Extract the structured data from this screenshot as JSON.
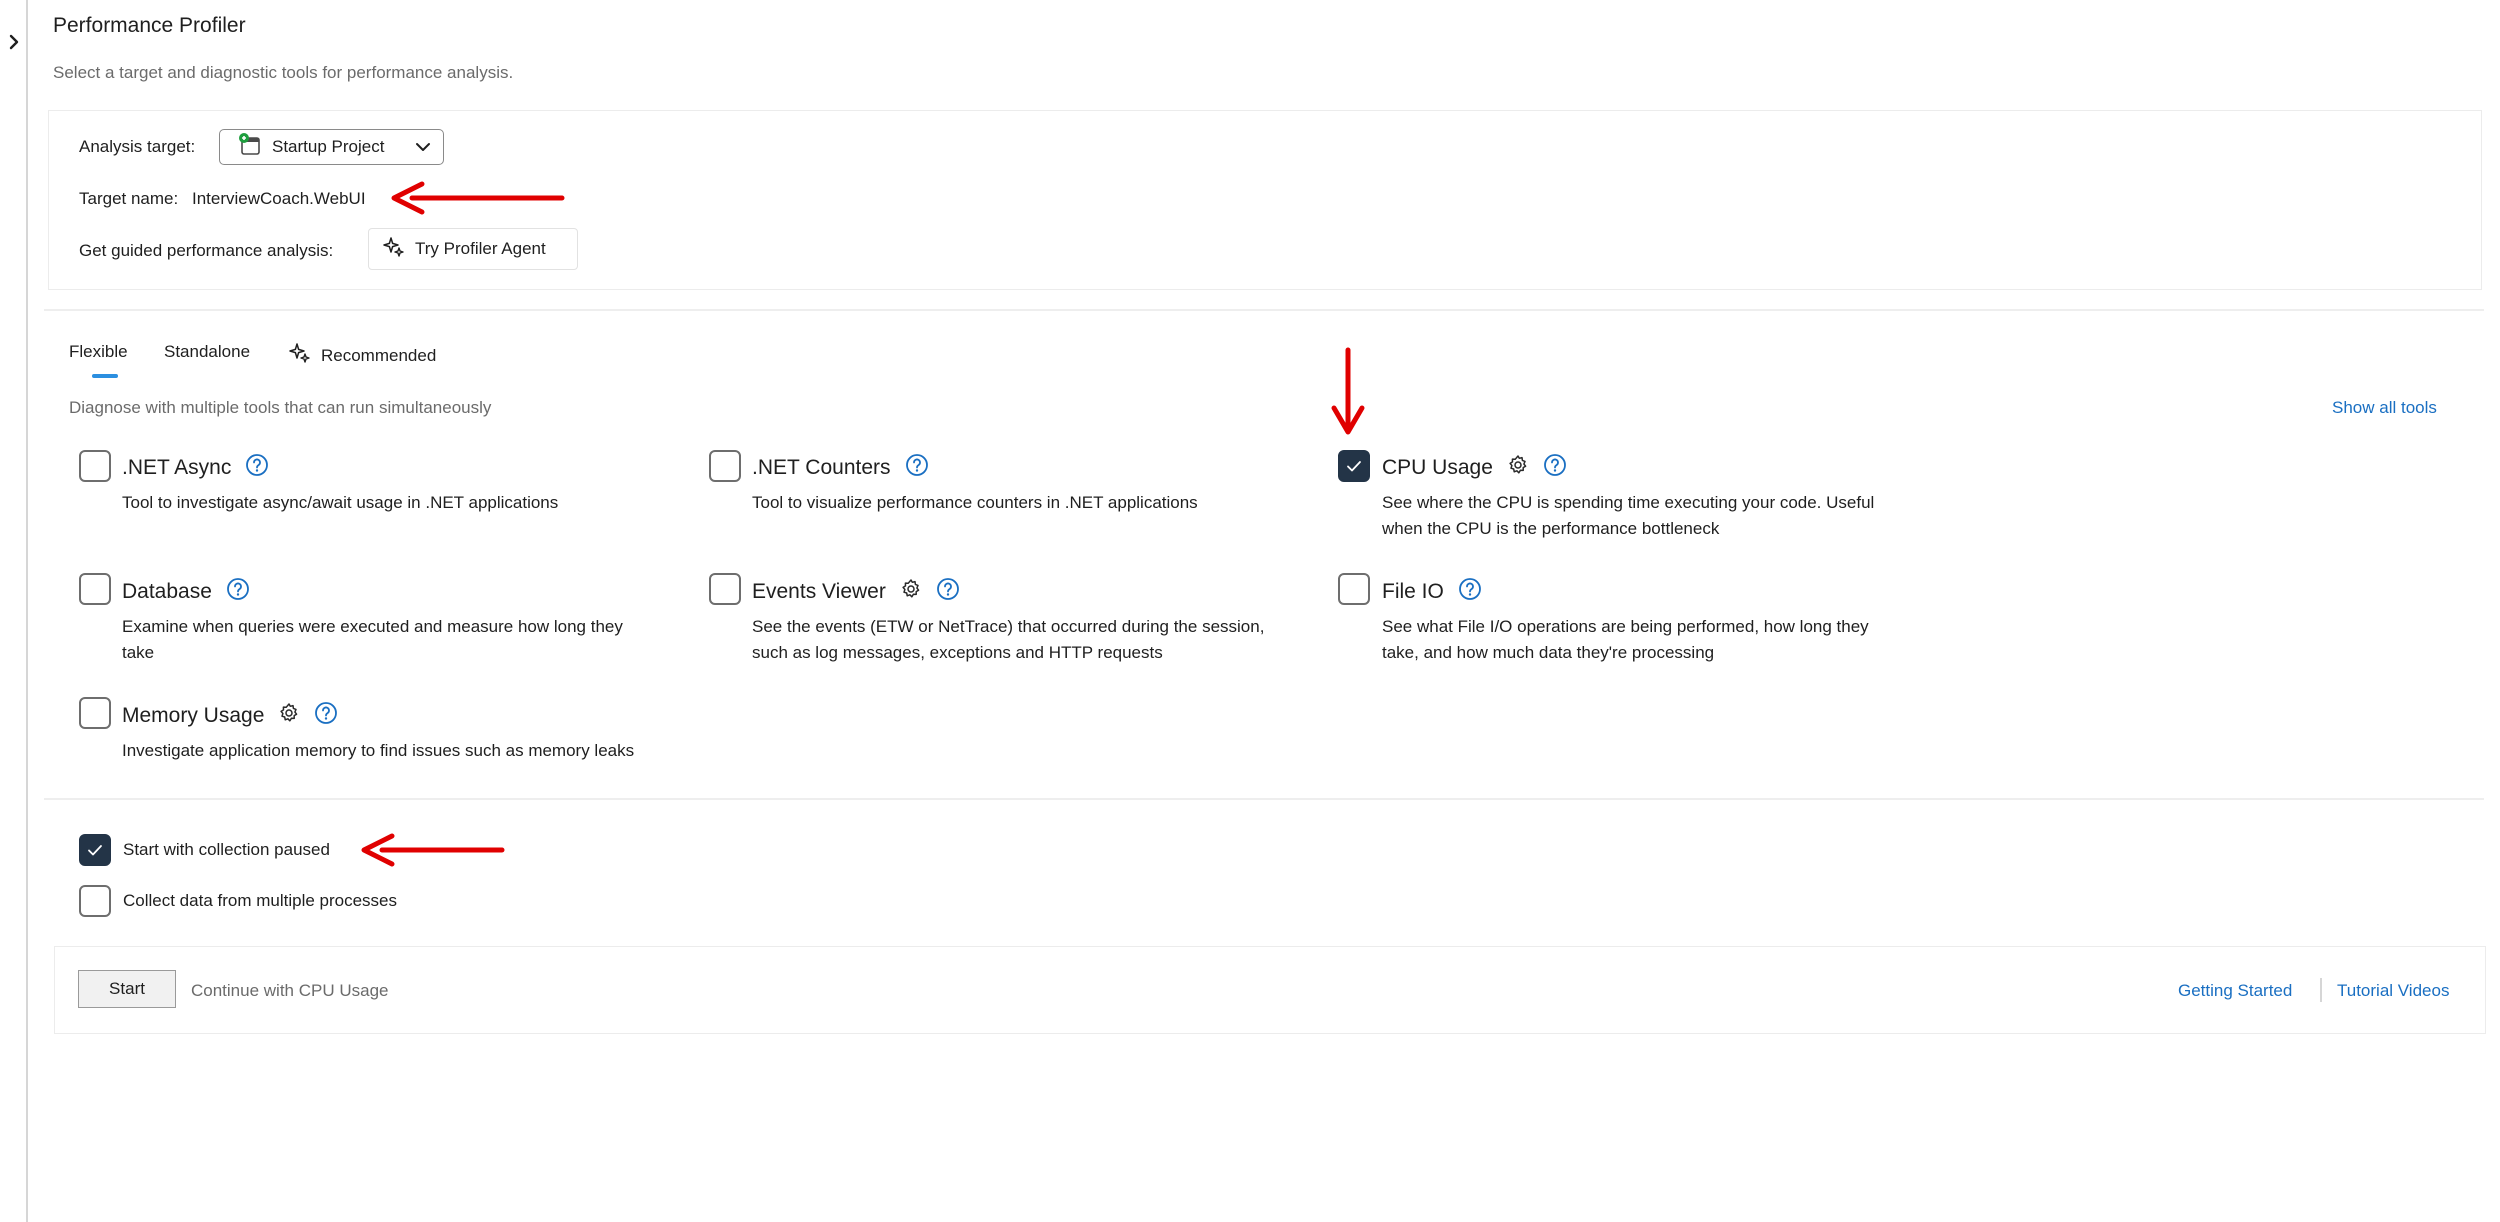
{
  "header": {
    "title": "Performance Profiler",
    "subtitle": "Select a target and diagnostic tools for performance analysis."
  },
  "target": {
    "analysis_label": "Analysis target:",
    "analysis_value": "Startup Project",
    "name_label": "Target name:",
    "name_value": "InterviewCoach.WebUI",
    "guided_label": "Get guided performance analysis:",
    "agent_button": "Try Profiler Agent"
  },
  "tabs": [
    {
      "label": "Flexible",
      "active": true
    },
    {
      "label": "Standalone",
      "active": false
    },
    {
      "label": "Recommended",
      "active": false
    }
  ],
  "tools_section": {
    "description": "Diagnose with multiple tools that can run simultaneously",
    "show_all": "Show all tools"
  },
  "tools": [
    {
      "name": ".NET Async",
      "desc": [
        "Tool to investigate async/await usage in .NET applications"
      ],
      "checked": false,
      "has_settings": false
    },
    {
      "name": ".NET Counters",
      "desc": [
        "Tool to visualize performance counters in .NET applications"
      ],
      "checked": false,
      "has_settings": false
    },
    {
      "name": "CPU Usage",
      "desc": [
        "See where the CPU is spending time executing your code. Useful",
        "when the CPU is the performance bottleneck"
      ],
      "checked": true,
      "has_settings": true
    },
    {
      "name": "Database",
      "desc": [
        "Examine when queries were executed and measure how long they",
        "take"
      ],
      "checked": false,
      "has_settings": false
    },
    {
      "name": "Events Viewer",
      "desc": [
        "See the events (ETW or NetTrace) that occurred during the session,",
        "such as log messages, exceptions and HTTP requests"
      ],
      "checked": false,
      "has_settings": true
    },
    {
      "name": "File IO",
      "desc": [
        "See what File I/O operations are being performed, how long they",
        "take, and how much data they're processing"
      ],
      "checked": false,
      "has_settings": false
    },
    {
      "name": "Memory Usage",
      "desc": [
        "Investigate application memory to find issues such as memory leaks"
      ],
      "checked": false,
      "has_settings": true
    }
  ],
  "options": [
    {
      "label": "Start with collection paused",
      "checked": true
    },
    {
      "label": "Collect data from multiple processes",
      "checked": false
    }
  ],
  "footer": {
    "start_label": "Start",
    "continue_text": "Continue with CPU Usage",
    "getting_started": "Getting Started",
    "tutorial_videos": "Tutorial Videos"
  },
  "colors": {
    "accent": "#2b8fe0",
    "link": "#1a6fc2",
    "checkbox_checked": "#233447",
    "annotation": "#e00000"
  }
}
